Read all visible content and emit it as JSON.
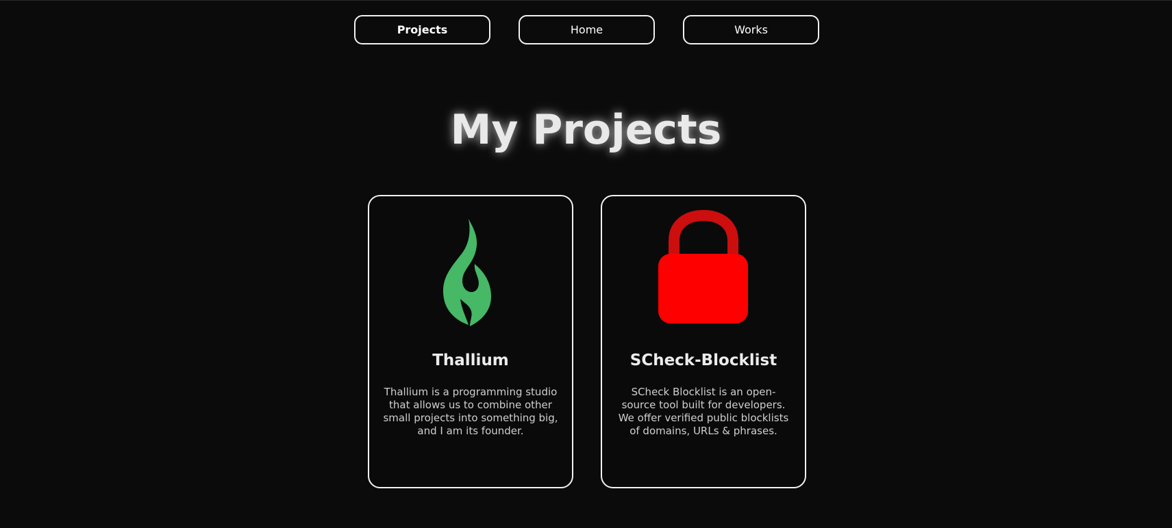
{
  "nav": {
    "items": [
      {
        "label": "Projects",
        "active": true
      },
      {
        "label": "Home",
        "active": false
      },
      {
        "label": "Works",
        "active": false
      }
    ]
  },
  "page": {
    "heading": "My Projects"
  },
  "projects": [
    {
      "title": "Thallium",
      "description": "Thallium is a programming studio that allows us to combine other small projects into something big, and I am its founder.",
      "icon": "flame-icon",
      "icon_color": "#46b866"
    },
    {
      "title": "SCheck-Blocklist",
      "description": "SCheck Blocklist is an open-source tool built for developers. We offer verified public blocklists of domains, URLs & phrases.",
      "icon": "lock-icon",
      "icon_color": "#ff0000",
      "shackle_color": "#cc0e0e"
    }
  ],
  "colors": {
    "background": "#0b0b0b",
    "border": "#f2f2f2"
  }
}
